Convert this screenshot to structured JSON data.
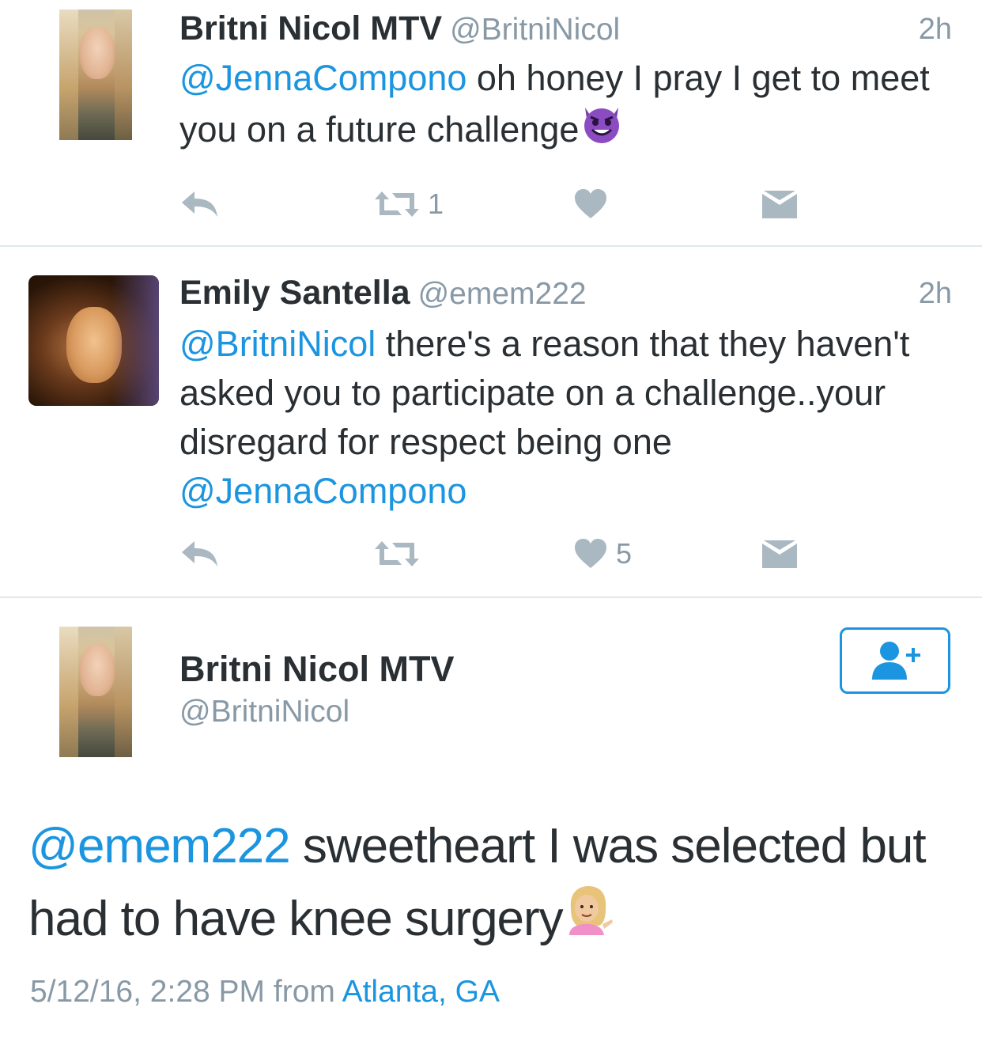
{
  "tweets": [
    {
      "name": "Britni Nicol MTV",
      "handle": "@BritniNicol",
      "time": "2h",
      "mention": "@JennaCompono",
      "text": " oh honey I pray I get to meet you on a future challenge",
      "emoji": "smiling-imp-emoji",
      "retweet_count": "1",
      "like_count": ""
    },
    {
      "name": "Emily Santella",
      "handle": "@emem222",
      "time": "2h",
      "mention": "@BritniNicol",
      "text": " there's a reason that they haven't asked you to participate on a challenge..your disregard for respect being one ",
      "mention2": "@JennaCompono",
      "retweet_count": "",
      "like_count": "5"
    }
  ],
  "detail": {
    "name": "Britni Nicol MTV",
    "handle": "@BritniNicol",
    "mention": "@emem222",
    "text": " sweetheart I was selected but had to have knee surgery",
    "emoji": "information-desk-person-emoji",
    "date": "5/12/16, 2:28 PM from ",
    "location": "Atlanta, GA",
    "follow_icon": "add-user-icon"
  },
  "icons": {
    "reply": "reply-icon",
    "retweet": "retweet-icon",
    "like": "heart-icon",
    "dm": "envelope-icon"
  },
  "colors": {
    "link": "#1b95e0",
    "secondary_text": "#8899a6",
    "icon": "#aab8c2",
    "text": "#292f33"
  }
}
